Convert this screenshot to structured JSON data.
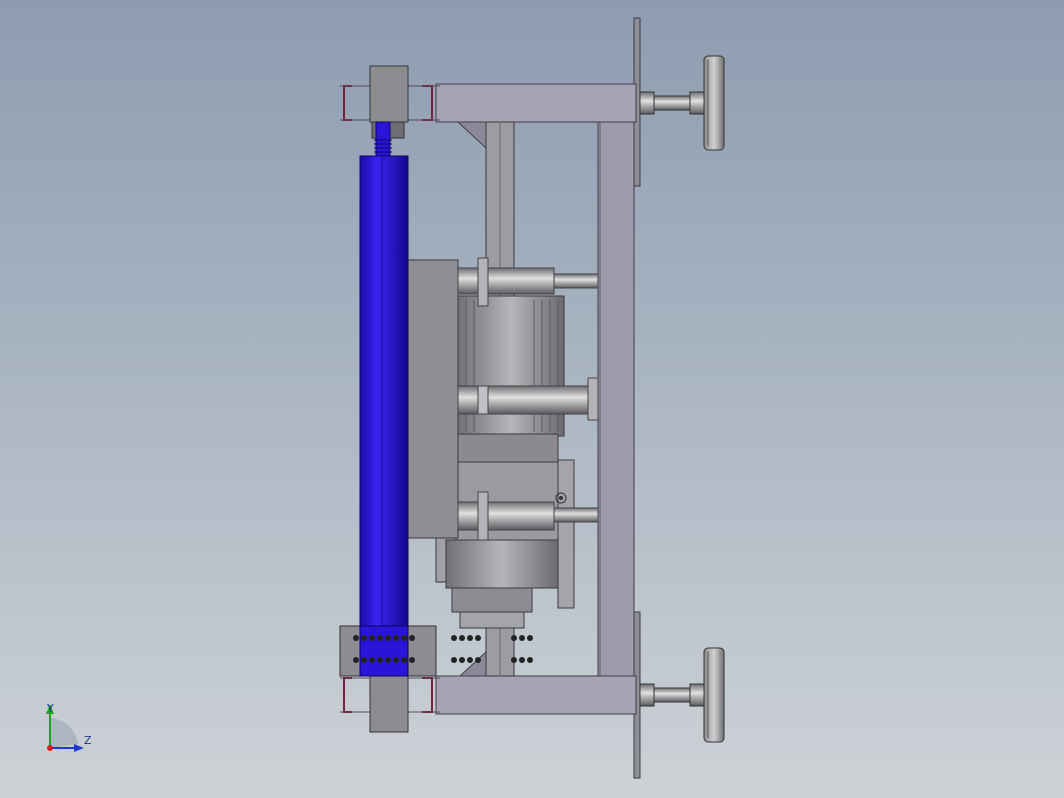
{
  "viewport": {
    "background_top": "#8d9cb0",
    "background_bottom": "#cdd2d6"
  },
  "colors": {
    "roller": "#2a14d8",
    "roller_edge": "#12087a",
    "steel": "#8f8f94",
    "steel_dark": "#4a4a50",
    "steel_light": "#c9c9cc",
    "plate": "#9a9aa0",
    "frame": "#a39cae",
    "channel": "#7a1f3a",
    "axis_x": "#d21f1f",
    "axis_y": "#1fa21f",
    "axis_z": "#1f3ad2"
  },
  "triad": {
    "y_label": "Y",
    "z_label": "Z"
  }
}
